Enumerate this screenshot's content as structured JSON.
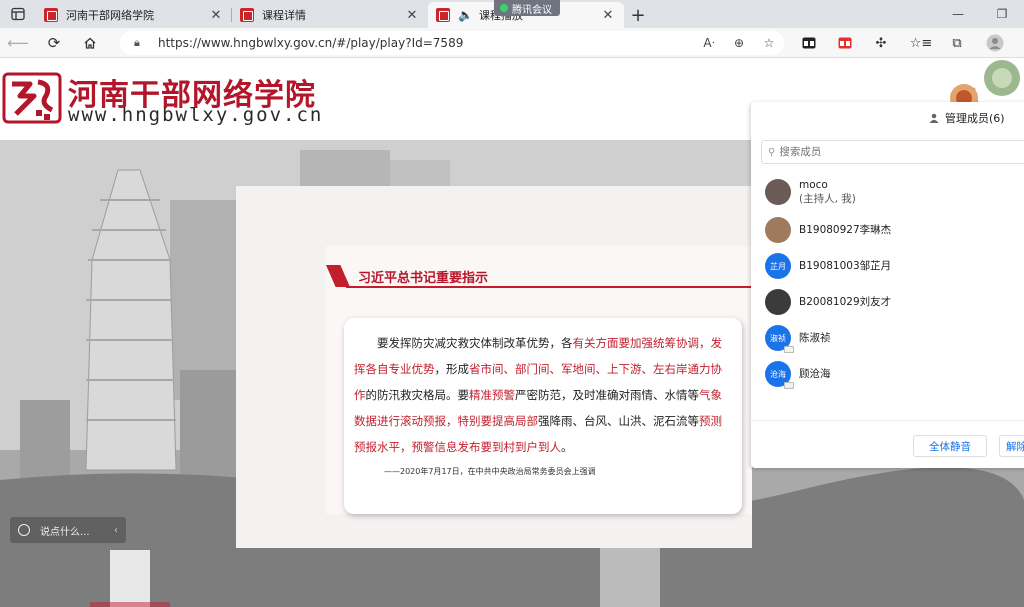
{
  "browser": {
    "tabs": [
      {
        "title": "河南干部网络学院"
      },
      {
        "title": "课程详情"
      },
      {
        "title": "课程播放"
      }
    ],
    "meeting_label": "腾讯会议",
    "url": "https://www.hngbwlxy.gov.cn/#/play/play?Id=7589",
    "new_tab": "+",
    "window_controls": {
      "minimize": "—",
      "restore": "❐"
    }
  },
  "site": {
    "name_cn": "河南干部网络学院",
    "domain": "www.hngbwlxy.gov.cn"
  },
  "slide": {
    "title": "习近平总书记重要指示",
    "quote_parts": [
      {
        "t": "要发挥防灾减灾救灾体制改革优势，各",
        "red": false
      },
      {
        "t": "有关方面要加强统筹协调，发挥各自专业优势",
        "red": true
      },
      {
        "t": "，形成",
        "red": false
      },
      {
        "t": "省市间、部门间、军地间、上下游、左右岸通力协作",
        "red": true
      },
      {
        "t": "的防汛救灾格局。要",
        "red": false
      },
      {
        "t": "精准预警",
        "red": true
      },
      {
        "t": "严密防范，及时准确对雨情、水情等",
        "red": false
      },
      {
        "t": "气象数据进行滚动预报，特别要提高局部",
        "red": true
      },
      {
        "t": "强降雨、台风、山洪、泥石流等",
        "red": false
      },
      {
        "t": "预测预报水平，预警信息发布要到村到户到人",
        "red": true
      },
      {
        "t": "。",
        "red": false
      }
    ],
    "source": "——2020年7月17日，在中共中央政治局常务委员会上强调"
  },
  "chat": {
    "placeholder": "说点什么..."
  },
  "panel": {
    "title": "管理成员(6)",
    "search_placeholder": "搜索成员",
    "members": [
      {
        "name": "moco",
        "sub": "(主持人, 我)",
        "avatar_text": "",
        "avatar_color": "#6b5a55"
      },
      {
        "name": "B19080927李琳杰",
        "sub": "",
        "avatar_text": "",
        "avatar_color": "#a07a5c"
      },
      {
        "name": "B19081003邹芷月",
        "sub": "",
        "avatar_text": "芷月",
        "avatar_color": "#1a73e8"
      },
      {
        "name": "B20081029刘友才",
        "sub": "",
        "avatar_text": "",
        "avatar_color": "#3b3b3b"
      },
      {
        "name": "陈淑祯",
        "sub": "",
        "avatar_text": "淑祯",
        "avatar_color": "#1a73e8"
      },
      {
        "name": "顾沧海",
        "sub": "",
        "avatar_text": "沧海",
        "avatar_color": "#1a73e8"
      }
    ],
    "mute_all": "全体静音",
    "unmute_all": "解除"
  },
  "colors": {
    "brand_red": "#b3162a",
    "accent_blue": "#1a73e8"
  }
}
